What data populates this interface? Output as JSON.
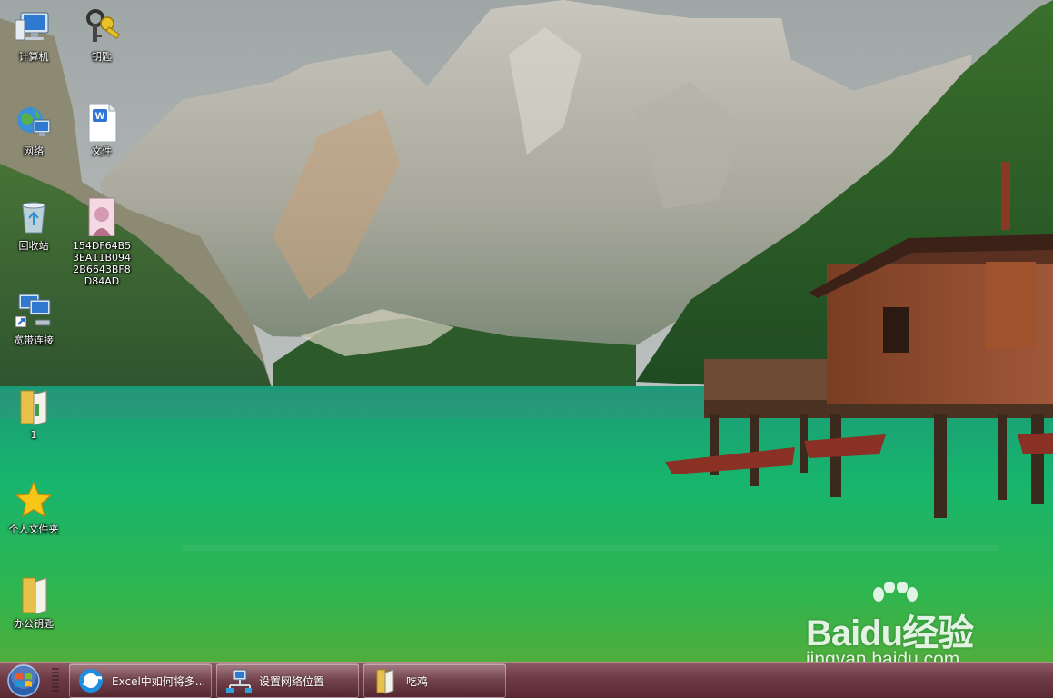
{
  "desktop": {
    "icons": [
      {
        "label": "计算机",
        "icon": "computer-icon"
      },
      {
        "label": "钥匙",
        "icon": "keys-icon"
      },
      {
        "label": "网络",
        "icon": "network-globe-icon"
      },
      {
        "label": "文件",
        "icon": "wps-document-icon"
      },
      {
        "label": "回收站",
        "icon": "recycle-bin-icon"
      },
      {
        "label": "154DF64B53EA11B0942B6643BF8D84AD",
        "icon": "image-file-icon"
      },
      {
        "label": "宽带连接",
        "icon": "broadband-connection-icon"
      },
      {
        "label": "1",
        "icon": "folder-icon"
      },
      {
        "label": "个人文件夹",
        "icon": "star-icon"
      },
      {
        "label": "办公钥匙",
        "icon": "folder-icon"
      }
    ]
  },
  "watermark": {
    "brand": "Baidu经验",
    "site": "jingyan.baidu.com"
  },
  "taskbar": {
    "start": {
      "icon": "windows-start-orb-icon"
    },
    "buttons": [
      {
        "label": "Excel中如何将多...",
        "icon": "browser-icon"
      },
      {
        "label": "设置网络位置",
        "icon": "network-settings-icon"
      },
      {
        "label": "吃鸡",
        "icon": "folder-icon"
      }
    ]
  },
  "colors": {
    "taskbar": "#6d3a43",
    "lake": "#17a56a",
    "label_text": "#ffffff"
  }
}
